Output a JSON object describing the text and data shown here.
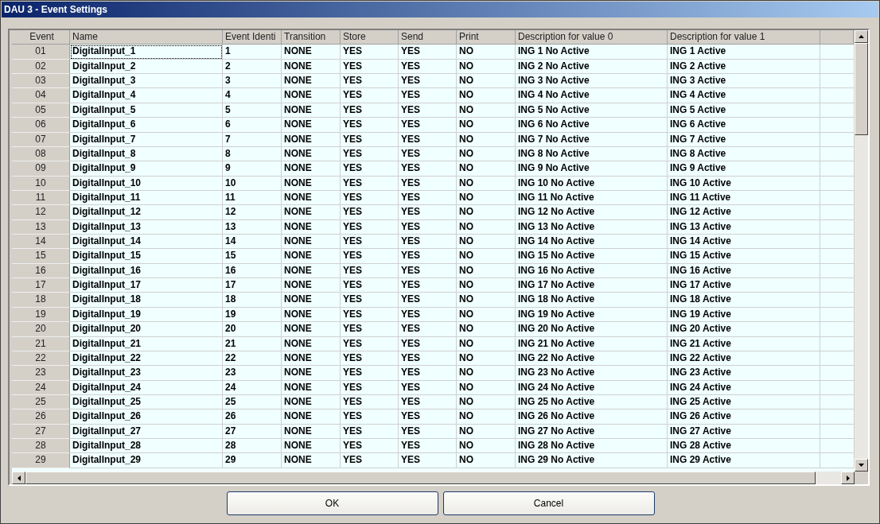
{
  "window": {
    "title": "DAU 3 - Event Settings"
  },
  "table": {
    "columns": [
      "Event",
      "Name",
      "Event Identi",
      "Transition",
      "Store",
      "Send",
      "Print",
      "Description for value 0",
      "Description for value 1"
    ],
    "rows": [
      {
        "cells": [
          "01",
          "DigitalInput_1",
          "1",
          "NONE",
          "YES",
          "YES",
          "NO",
          "ING 1 No Active",
          "ING 1 Active"
        ],
        "focused": true
      },
      {
        "cells": [
          "02",
          "DigitalInput_2",
          "2",
          "NONE",
          "YES",
          "YES",
          "NO",
          "ING 2 No Active",
          "ING 2 Active"
        ],
        "focused": false
      },
      {
        "cells": [
          "03",
          "DigitalInput_3",
          "3",
          "NONE",
          "YES",
          "YES",
          "NO",
          "ING 3 No Active",
          "ING 3 Active"
        ],
        "focused": false
      },
      {
        "cells": [
          "04",
          "DigitalInput_4",
          "4",
          "NONE",
          "YES",
          "YES",
          "NO",
          "ING 4 No Active",
          "ING 4 Active"
        ],
        "focused": false
      },
      {
        "cells": [
          "05",
          "DigitalInput_5",
          "5",
          "NONE",
          "YES",
          "YES",
          "NO",
          "ING 5 No Active",
          "ING 5 Active"
        ],
        "focused": false
      },
      {
        "cells": [
          "06",
          "DigitalInput_6",
          "6",
          "NONE",
          "YES",
          "YES",
          "NO",
          "ING 6 No Active",
          "ING 6 Active"
        ],
        "focused": false
      },
      {
        "cells": [
          "07",
          "DigitalInput_7",
          "7",
          "NONE",
          "YES",
          "YES",
          "NO",
          "ING 7 No Active",
          "ING 7 Active"
        ],
        "focused": false
      },
      {
        "cells": [
          "08",
          "DigitalInput_8",
          "8",
          "NONE",
          "YES",
          "YES",
          "NO",
          "ING 8 No Active",
          "ING 8 Active"
        ],
        "focused": false
      },
      {
        "cells": [
          "09",
          "DigitalInput_9",
          "9",
          "NONE",
          "YES",
          "YES",
          "NO",
          "ING 9 No Active",
          "ING 9 Active"
        ],
        "focused": false
      },
      {
        "cells": [
          "10",
          "DigitalInput_10",
          "10",
          "NONE",
          "YES",
          "YES",
          "NO",
          "ING 10 No Active",
          "ING 10 Active"
        ],
        "focused": false
      },
      {
        "cells": [
          "11",
          "DigitalInput_11",
          "11",
          "NONE",
          "YES",
          "YES",
          "NO",
          "ING 11 No Active",
          "ING 11 Active"
        ],
        "focused": false
      },
      {
        "cells": [
          "12",
          "DigitalInput_12",
          "12",
          "NONE",
          "YES",
          "YES",
          "NO",
          "ING 12 No Active",
          "ING 12 Active"
        ],
        "focused": false
      },
      {
        "cells": [
          "13",
          "DigitalInput_13",
          "13",
          "NONE",
          "YES",
          "YES",
          "NO",
          "ING 13 No Active",
          "ING 13 Active"
        ],
        "focused": false
      },
      {
        "cells": [
          "14",
          "DigitalInput_14",
          "14",
          "NONE",
          "YES",
          "YES",
          "NO",
          "ING 14 No Active",
          "ING 14 Active"
        ],
        "focused": false
      },
      {
        "cells": [
          "15",
          "DigitalInput_15",
          "15",
          "NONE",
          "YES",
          "YES",
          "NO",
          "ING 15 No Active",
          "ING 15 Active"
        ],
        "focused": false
      },
      {
        "cells": [
          "16",
          "DigitalInput_16",
          "16",
          "NONE",
          "YES",
          "YES",
          "NO",
          "ING 16 No Active",
          "ING 16 Active"
        ],
        "focused": false
      },
      {
        "cells": [
          "17",
          "DigitalInput_17",
          "17",
          "NONE",
          "YES",
          "YES",
          "NO",
          "ING 17 No Active",
          "ING 17 Active"
        ],
        "focused": false
      },
      {
        "cells": [
          "18",
          "DigitalInput_18",
          "18",
          "NONE",
          "YES",
          "YES",
          "NO",
          "ING 18 No Active",
          "ING 18 Active"
        ],
        "focused": false
      },
      {
        "cells": [
          "19",
          "DigitalInput_19",
          "19",
          "NONE",
          "YES",
          "YES",
          "NO",
          "ING 19 No Active",
          "ING 19 Active"
        ],
        "focused": false
      },
      {
        "cells": [
          "20",
          "DigitalInput_20",
          "20",
          "NONE",
          "YES",
          "YES",
          "NO",
          "ING 20 No Active",
          "ING 20 Active"
        ],
        "focused": false
      },
      {
        "cells": [
          "21",
          "DigitalInput_21",
          "21",
          "NONE",
          "YES",
          "YES",
          "NO",
          "ING 21 No Active",
          "ING 21 Active"
        ],
        "focused": false
      },
      {
        "cells": [
          "22",
          "DigitalInput_22",
          "22",
          "NONE",
          "YES",
          "YES",
          "NO",
          "ING 22 No Active",
          "ING 22 Active"
        ],
        "focused": false
      },
      {
        "cells": [
          "23",
          "DigitalInput_23",
          "23",
          "NONE",
          "YES",
          "YES",
          "NO",
          "ING 23 No Active",
          "ING 23 Active"
        ],
        "focused": false
      },
      {
        "cells": [
          "24",
          "DigitalInput_24",
          "24",
          "NONE",
          "YES",
          "YES",
          "NO",
          "ING 24 No Active",
          "ING 24 Active"
        ],
        "focused": false
      },
      {
        "cells": [
          "25",
          "DigitalInput_25",
          "25",
          "NONE",
          "YES",
          "YES",
          "NO",
          "ING 25 No Active",
          "ING 25 Active"
        ],
        "focused": false
      },
      {
        "cells": [
          "26",
          "DigitalInput_26",
          "26",
          "NONE",
          "YES",
          "YES",
          "NO",
          "ING 26 No Active",
          "ING 26 Active"
        ],
        "focused": false
      },
      {
        "cells": [
          "27",
          "DigitalInput_27",
          "27",
          "NONE",
          "YES",
          "YES",
          "NO",
          "ING 27 No Active",
          "ING 27 Active"
        ],
        "focused": false
      },
      {
        "cells": [
          "28",
          "DigitalInput_28",
          "28",
          "NONE",
          "YES",
          "YES",
          "NO",
          "ING 28 No Active",
          "ING 28 Active"
        ],
        "focused": false
      },
      {
        "cells": [
          "29",
          "DigitalInput_29",
          "29",
          "NONE",
          "YES",
          "YES",
          "NO",
          "ING 29 No Active",
          "ING 29 Active"
        ],
        "focused": false
      }
    ]
  },
  "buttons": [
    "OK",
    "Cancel"
  ]
}
